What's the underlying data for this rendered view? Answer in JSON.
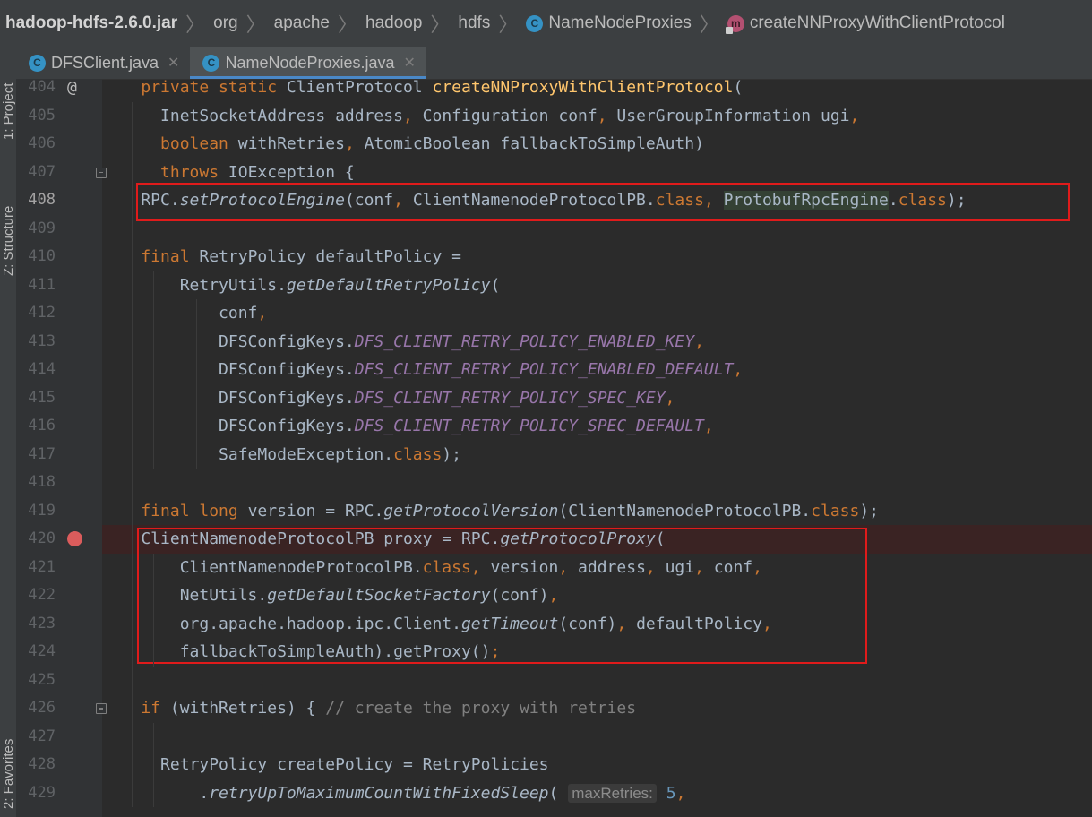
{
  "breadcrumb": {
    "jar": "hadoop-hdfs-2.6.0.jar",
    "items": [
      "org",
      "apache",
      "hadoop",
      "hdfs"
    ],
    "class_name": "NameNodeProxies",
    "method_name": "createNNProxyWithClientProtocol"
  },
  "tabs": [
    {
      "label": "DFSClient.java",
      "active": false
    },
    {
      "label": "NameNodeProxies.java",
      "active": true
    }
  ],
  "side_panels": {
    "project": "1: Project",
    "structure": "Z: Structure",
    "favorites": "2: Favorites"
  },
  "editor": {
    "line_numbers": [
      "404",
      "405",
      "406",
      "407",
      "408",
      "409",
      "410",
      "411",
      "412",
      "413",
      "414",
      "415",
      "416",
      "417",
      "418",
      "419",
      "420",
      "421",
      "422",
      "423",
      "424",
      "425",
      "426",
      "427",
      "428",
      "429"
    ],
    "lines": [
      [
        [
          "    ",
          ""
        ],
        [
          "private static ",
          "kw"
        ],
        [
          "ClientProtocol ",
          ""
        ],
        [
          "createNNProxyWithClientProtocol",
          "fn"
        ],
        [
          "(",
          ""
        ]
      ],
      [
        [
          "      InetSocketAddress address",
          ""
        ],
        [
          ", ",
          "kw"
        ],
        [
          "Configuration conf",
          ""
        ],
        [
          ", ",
          "kw"
        ],
        [
          "UserGroupInformation ugi",
          ""
        ],
        [
          ",",
          "kw"
        ]
      ],
      [
        [
          "      ",
          ""
        ],
        [
          "boolean ",
          "kw"
        ],
        [
          "withRetries",
          ""
        ],
        [
          ", ",
          "kw"
        ],
        [
          "AtomicBoolean fallbackToSimpleAuth)",
          ""
        ]
      ],
      [
        [
          "      ",
          ""
        ],
        [
          "throws ",
          "kw"
        ],
        [
          "IOException {",
          ""
        ]
      ],
      [
        [
          "    RPC.",
          ""
        ],
        [
          "setProtocolEngine",
          "it"
        ],
        [
          "(conf",
          ""
        ],
        [
          ", ",
          "kw"
        ],
        [
          "ClientNamenodeProtocolPB.",
          ""
        ],
        [
          "class",
          "kw"
        ],
        [
          ", ",
          "kw"
        ],
        [
          "ProtobufRpcEngine",
          "hl"
        ],
        [
          ".",
          ""
        ],
        [
          "class",
          "kw"
        ],
        [
          ");",
          ""
        ]
      ],
      [],
      [
        [
          "    ",
          ""
        ],
        [
          "final ",
          "kw"
        ],
        [
          "RetryPolicy defaultPolicy =",
          ""
        ]
      ],
      [
        [
          "        RetryUtils.",
          ""
        ],
        [
          "getDefaultRetryPolicy",
          "it"
        ],
        [
          "(",
          ""
        ]
      ],
      [
        [
          "            conf",
          ""
        ],
        [
          ",",
          "kw"
        ]
      ],
      [
        [
          "            DFSConfigKeys.",
          ""
        ],
        [
          "DFS_CLIENT_RETRY_POLICY_ENABLED_KEY",
          "cst"
        ],
        [
          ",",
          "kw"
        ]
      ],
      [
        [
          "            DFSConfigKeys.",
          ""
        ],
        [
          "DFS_CLIENT_RETRY_POLICY_ENABLED_DEFAULT",
          "cst"
        ],
        [
          ",",
          "kw"
        ]
      ],
      [
        [
          "            DFSConfigKeys.",
          ""
        ],
        [
          "DFS_CLIENT_RETRY_POLICY_SPEC_KEY",
          "cst"
        ],
        [
          ",",
          "kw"
        ]
      ],
      [
        [
          "            DFSConfigKeys.",
          ""
        ],
        [
          "DFS_CLIENT_RETRY_POLICY_SPEC_DEFAULT",
          "cst"
        ],
        [
          ",",
          "kw"
        ]
      ],
      [
        [
          "            SafeModeException.",
          ""
        ],
        [
          "class",
          "kw"
        ],
        [
          ");",
          ""
        ]
      ],
      [],
      [
        [
          "    ",
          ""
        ],
        [
          "final long ",
          "kw"
        ],
        [
          "version = RPC.",
          ""
        ],
        [
          "getProtocolVersion",
          "it"
        ],
        [
          "(ClientNamenodeProtocolPB.",
          ""
        ],
        [
          "class",
          "kw"
        ],
        [
          ");",
          ""
        ]
      ],
      [
        [
          "    ClientNamenodeProtocolPB proxy = RPC.",
          ""
        ],
        [
          "getProtocolProxy",
          "it"
        ],
        [
          "(",
          ""
        ]
      ],
      [
        [
          "        ClientNamenodeProtocolPB.",
          ""
        ],
        [
          "class",
          "kw"
        ],
        [
          ", ",
          "kw"
        ],
        [
          "version",
          ""
        ],
        [
          ", ",
          "kw"
        ],
        [
          "address",
          ""
        ],
        [
          ", ",
          "kw"
        ],
        [
          "ugi",
          ""
        ],
        [
          ", ",
          "kw"
        ],
        [
          "conf",
          ""
        ],
        [
          ",",
          "kw"
        ]
      ],
      [
        [
          "        NetUtils.",
          ""
        ],
        [
          "getDefaultSocketFactory",
          "it"
        ],
        [
          "(conf)",
          ""
        ],
        [
          ",",
          "kw"
        ]
      ],
      [
        [
          "        org.apache.hadoop.ipc.Client.",
          ""
        ],
        [
          "getTimeout",
          "it"
        ],
        [
          "(conf)",
          ""
        ],
        [
          ", ",
          "kw"
        ],
        [
          "defaultPolicy",
          ""
        ],
        [
          ",",
          "kw"
        ]
      ],
      [
        [
          "        fallbackToSimpleAuth).getProxy()",
          ""
        ],
        [
          ";",
          "kw"
        ]
      ],
      [],
      [
        [
          "    ",
          ""
        ],
        [
          "if ",
          "kw"
        ],
        [
          "(withRetries) { ",
          ""
        ],
        [
          "// create the proxy with retries",
          "cmt"
        ]
      ],
      [],
      [
        [
          "      RetryPolicy createPolicy = RetryPolicies",
          ""
        ]
      ],
      [
        [
          "          .",
          ""
        ],
        [
          "retryUpToMaximumCountWithFixedSleep",
          "it"
        ],
        [
          "( ",
          ""
        ],
        [
          "maxRetries:",
          "hint"
        ],
        [
          " ",
          ""
        ],
        [
          "5",
          "num"
        ],
        [
          ",",
          "kw"
        ]
      ]
    ]
  }
}
